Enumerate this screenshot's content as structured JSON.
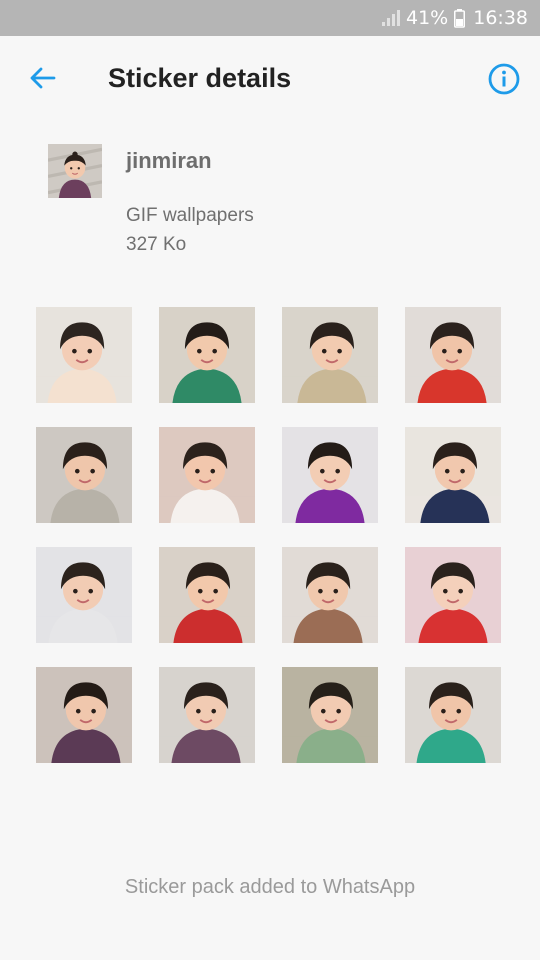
{
  "status_bar": {
    "battery_percent": "41%",
    "time": "16:38"
  },
  "app_bar": {
    "title": "Sticker details",
    "back_icon": "arrow-back-icon",
    "info_icon": "info-icon",
    "accent_color": "#1e9be9"
  },
  "pack": {
    "name": "jinmiran",
    "publisher": "GIF wallpapers",
    "size": "327 Ko"
  },
  "stickers": [
    {
      "bg": "#e7e3dd",
      "skin": "#f3cdb6",
      "hair": "#2d2520",
      "cloth": "#f4e1d0"
    },
    {
      "bg": "#d8d2c8",
      "skin": "#f1c9ac",
      "hair": "#231c18",
      "cloth": "#2f8a66"
    },
    {
      "bg": "#d9d4cb",
      "skin": "#f2cbb0",
      "hair": "#2a211c",
      "cloth": "#c9b896"
    },
    {
      "bg": "#e1dcd8",
      "skin": "#f0c4a8",
      "hair": "#2b221d",
      "cloth": "#d8362c"
    },
    {
      "bg": "#cdc8c2",
      "skin": "#efc6ab",
      "hair": "#2a201a",
      "cloth": "#b7b2a8"
    },
    {
      "bg": "#ddc9c0",
      "skin": "#f2c7ad",
      "hair": "#2c221c",
      "cloth": "#f5f1ee"
    },
    {
      "bg": "#e4e2e5",
      "skin": "#f3cdb4",
      "hair": "#241c17",
      "cloth": "#7f2aa0"
    },
    {
      "bg": "#e9e5df",
      "skin": "#f1c8ae",
      "hair": "#2a201b",
      "cloth": "#263257"
    },
    {
      "bg": "#e3e3e6",
      "skin": "#f2ccb4",
      "hair": "#2c231d",
      "cloth": "#e6e6e8"
    },
    {
      "bg": "#d9d1c8",
      "skin": "#f2c8ab",
      "hair": "#2a201a",
      "cloth": "#cc2e2e"
    },
    {
      "bg": "#e1dbd6",
      "skin": "#f0c8ad",
      "hair": "#2a211b",
      "cloth": "#9b6d55"
    },
    {
      "bg": "#e8d0d4",
      "skin": "#f4d0bb",
      "hair": "#2b221d",
      "cloth": "#d83232"
    },
    {
      "bg": "#ccc2bb",
      "skin": "#f0c7ad",
      "hair": "#241b16",
      "cloth": "#5b3a55"
    },
    {
      "bg": "#d7d3ce",
      "skin": "#f1cbb3",
      "hair": "#2a211c",
      "cloth": "#6d4a63"
    },
    {
      "bg": "#b9b3a1",
      "skin": "#f2cbb2",
      "hair": "#262019",
      "cloth": "#8aaf8a"
    },
    {
      "bg": "#dcd8d3",
      "skin": "#f0c5a9",
      "hair": "#2a211b",
      "cloth": "#2fa88a"
    }
  ],
  "footer": {
    "status_text": "Sticker pack added to WhatsApp"
  }
}
